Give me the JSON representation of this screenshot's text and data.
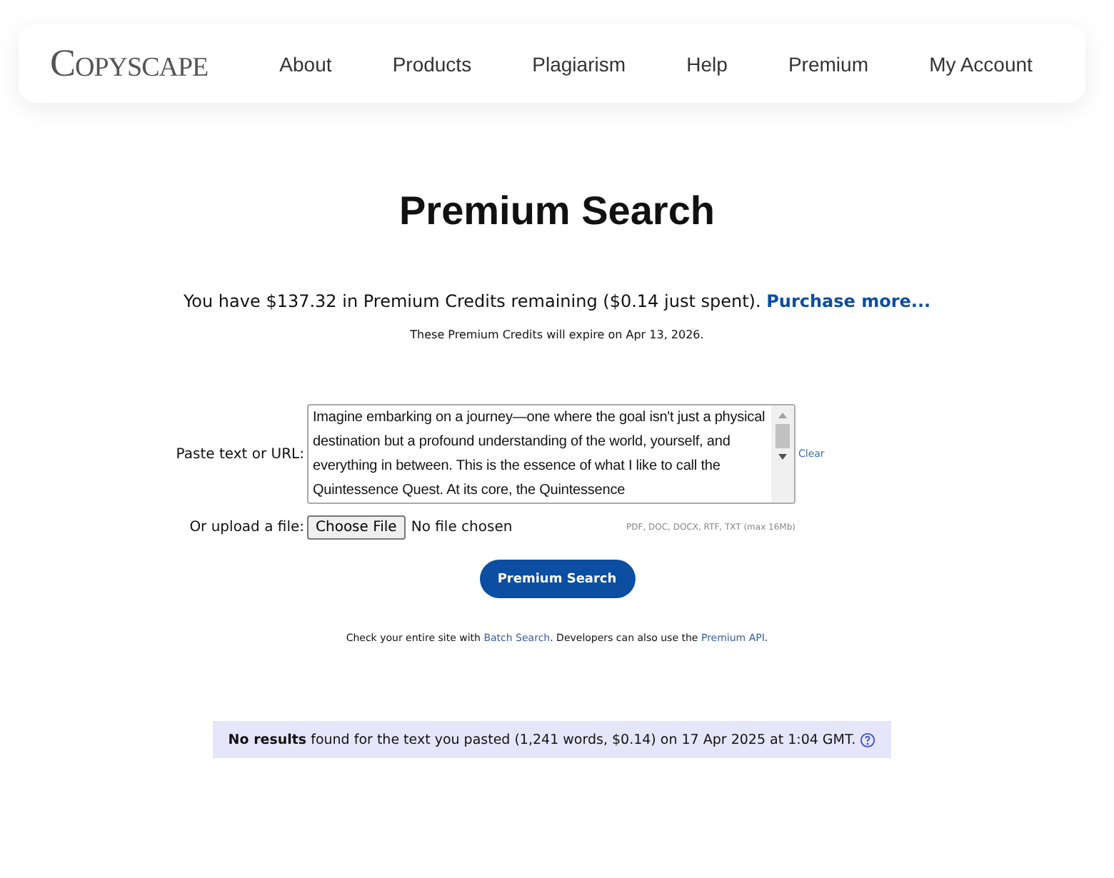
{
  "header": {
    "logo": "Copyscape",
    "nav": [
      {
        "label": "About"
      },
      {
        "label": "Products"
      },
      {
        "label": "Plagiarism"
      },
      {
        "label": "Help"
      },
      {
        "label": "Premium"
      },
      {
        "label": "My Account"
      }
    ]
  },
  "title": "Premium Search",
  "credits": {
    "text": "You have $137.32 in Premium Credits remaining ($0.14 just spent).",
    "link": "Purchase more..."
  },
  "expiry": "These Premium Credits will expire on Apr 13, 2026.",
  "form": {
    "text_label": "Paste text or URL:",
    "text_value": "Imagine embarking on a journey—one where the goal isn't just a physical destination but a profound understanding of the world, yourself, and everything in between. This is the essence of what I like to call the Quintessence Quest. At its core, the Quintessence",
    "clear": "Clear",
    "upload_label": "Or upload a file:",
    "choose_button": "Choose File",
    "file_status": "No file chosen",
    "formats": "PDF, DOC, DOCX, RTF, TXT (max 16Mb)",
    "submit": "Premium Search"
  },
  "footnote": {
    "before": "Check your entire site with",
    "link1": "Batch Search",
    "middle": ". Developers can also use the",
    "link2": "Premium API",
    "after": "."
  },
  "result": "**No results** found for the text you pasted (1,241 words, $0.14) on 17 Apr 2025 at 1:04 GMT."
}
